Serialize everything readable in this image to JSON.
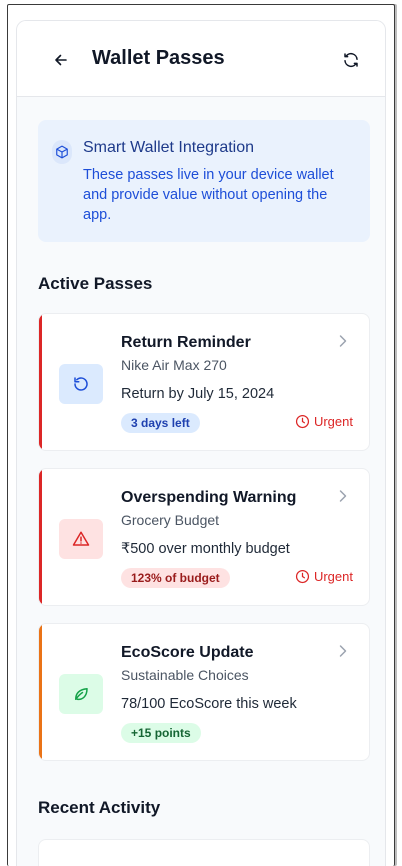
{
  "header": {
    "title": "Wallet Passes"
  },
  "info": {
    "title": "Smart Wallet Integration",
    "description": "These passes live in your device wallet and provide value without opening the app."
  },
  "sections": {
    "active": "Active Passes",
    "recent": "Recent Activity"
  },
  "passes": [
    {
      "title": "Return Reminder",
      "subtitle": "Nike Air Max 270",
      "detail": "Return by July 15, 2024",
      "badge": "3 days left",
      "urgent": "Urgent",
      "icon": "rotate-ccw-icon",
      "accent": "#dc2626"
    },
    {
      "title": "Overspending Warning",
      "subtitle": "Grocery Budget",
      "detail": "₹500 over monthly budget",
      "badge": "123% of budget",
      "urgent": "Urgent",
      "icon": "alert-triangle-icon",
      "accent": "#dc2626"
    },
    {
      "title": "EcoScore Update",
      "subtitle": "Sustainable Choices",
      "detail": "78/100 EcoScore this week",
      "badge": "+15 points",
      "icon": "leaf-icon",
      "accent": "#ea7317"
    }
  ],
  "colors": {
    "accent_red": "#dc2626",
    "accent_orange": "#ea7317",
    "info_bg": "#eaf2fd",
    "badge_blue_bg": "#dbeafe",
    "badge_red_bg": "#fee2e2",
    "badge_green_bg": "#dcfce7"
  }
}
